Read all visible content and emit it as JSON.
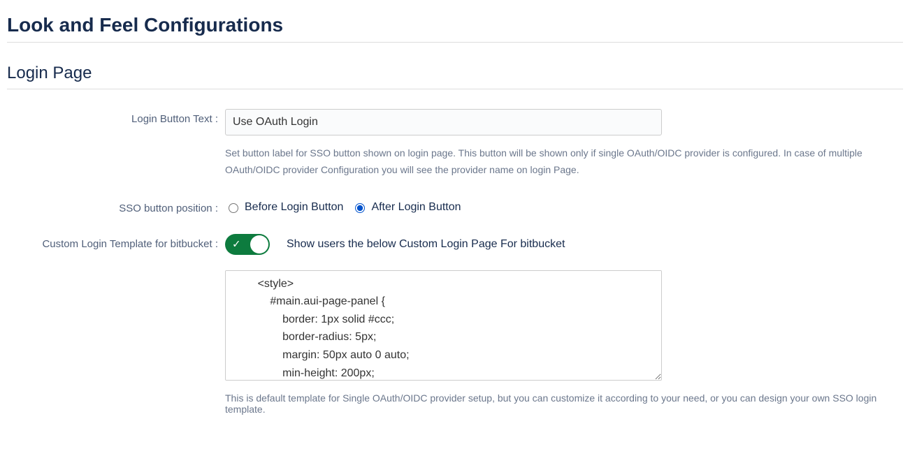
{
  "page": {
    "title": "Look and Feel Configurations",
    "section": "Login Page"
  },
  "loginButtonText": {
    "label": "Login Button Text :",
    "value": "Use OAuth Login",
    "help": "Set button label for SSO button shown on login page. This button will be shown only if single OAuth/OIDC provider is configured. In case of multiple OAuth/OIDC provider Configuration you will see the provider name on login Page."
  },
  "ssoPosition": {
    "label": "SSO button position :",
    "options": {
      "before": "Before Login Button",
      "after": "After Login Button"
    },
    "selected": "after"
  },
  "customTemplate": {
    "label": "Custom Login Template for bitbucket :",
    "enabled": true,
    "description": "Show users the below Custom Login Page For bitbucket",
    "code": "        <style>\n            #main.aui-page-panel {\n                border: 1px solid #ccc;\n                border-radius: 5px;\n                margin: 50px auto 0 auto;\n                min-height: 200px;",
    "footer": "This is default template for Single OAuth/OIDC provider setup, but you can customize it according to your need, or you can design your own SSO login template."
  }
}
